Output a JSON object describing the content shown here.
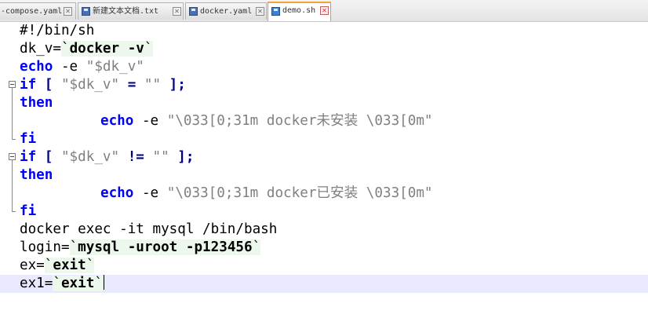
{
  "tabs": [
    {
      "label": "-compose.yaml",
      "close": "✕"
    },
    {
      "label": "新建文本文档.txt",
      "close": "✕"
    },
    {
      "label": "docker.yaml",
      "close": "✕"
    },
    {
      "label": "demo.sh",
      "close": "✕"
    }
  ],
  "code": {
    "l1": {
      "shebang": "#!/bin/sh"
    },
    "l2": {
      "var": "dk_v=",
      "q1": "`",
      "cmd": "docker -v",
      "q2": "`"
    },
    "l3": {
      "kw": "echo",
      "rest": " -e ",
      "str": "\"$dk_v\""
    },
    "l4": {
      "kw": "if",
      "b1": " [ ",
      "str1": "\"$dk_v\"",
      "sp1": " ",
      "op": "=",
      "sp2": " ",
      "str2": "\"\"",
      "b2": " ];"
    },
    "l5": {
      "kw": "then"
    },
    "l6": {
      "kw": "echo",
      "rest": " -e ",
      "str": "\"\\033[0;31m docker未安装 \\033[0m\""
    },
    "l7": {
      "kw": "fi"
    },
    "l8": {
      "kw": "if",
      "b1": " [ ",
      "str1": "\"$dk_v\"",
      "sp1": " ",
      "op": "!=",
      "sp2": " ",
      "str2": "\"\"",
      "b2": " ];"
    },
    "l9": {
      "kw": "then"
    },
    "l10": {
      "kw": "echo",
      "rest": " -e ",
      "str": "\"\\033[0;31m docker已安装 \\033[0m\""
    },
    "l11": {
      "kw": "fi"
    },
    "l12": {
      "text": "docker exec -it mysql /bin/bash"
    },
    "l13": {
      "var": "login=",
      "q1": "`",
      "cmd": "mysql -uroot -p123456",
      "q2": "`"
    },
    "l14": {
      "var": "ex=",
      "q1": "`",
      "cmd": "exit",
      "q2": "`"
    },
    "l15": {
      "var": "ex1=",
      "q1": "`",
      "cmd": "exit",
      "q2": "`"
    }
  },
  "colors": {
    "keyword": "#0000ff",
    "string": "#808080",
    "operator": "#000080",
    "backtick_bg": "#ecf8ec",
    "current_line": "#e8e8ff",
    "active_tab_accent": "#f4a53a"
  }
}
